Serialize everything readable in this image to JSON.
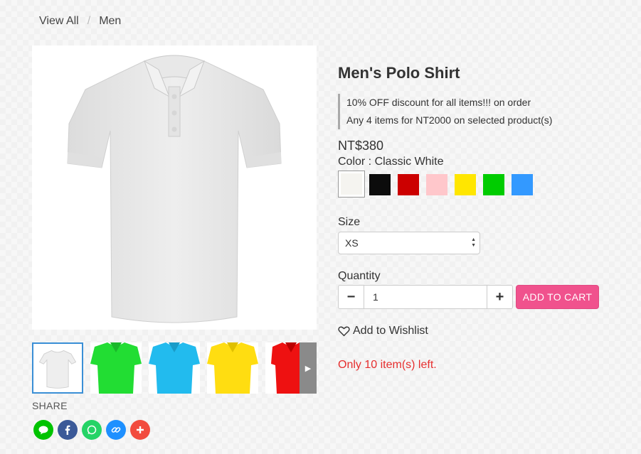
{
  "breadcrumb": {
    "items": [
      "View All",
      "Men"
    ],
    "separator": "/"
  },
  "product": {
    "title": "Men's Polo Shirt",
    "promotions": [
      "10% OFF discount for all items!!! on order",
      "Any 4 items for NT2000 on selected product(s)"
    ],
    "price": "NT$380",
    "color_label": "Color : Classic White",
    "colors": [
      "#f5f4f0",
      "#0c0c0c",
      "#cc0000",
      "#ffc7cb",
      "#ffe600",
      "#00cc00",
      "#3399ff"
    ],
    "selected_color_index": 0
  },
  "size": {
    "label": "Size",
    "value": "XS"
  },
  "quantity": {
    "label": "Quantity",
    "value": "1",
    "minus": "−",
    "plus": "+"
  },
  "add_to_cart": "ADD TO CART",
  "wishlist": "Add to Wishlist",
  "stock": "Only 10 item(s) left.",
  "gallery": {
    "thumbnail_colors": [
      "#f0f0f0",
      "#22dd33",
      "#22bbee",
      "#ffdd11",
      "#ee1111"
    ],
    "active_index": 0
  },
  "share": {
    "label": "SHARE",
    "buttons": [
      {
        "name": "line",
        "color": "#00c300",
        "icon": "line-icon"
      },
      {
        "name": "facebook",
        "color": "#3b5998",
        "icon": "facebook-icon"
      },
      {
        "name": "whatsapp",
        "color": "#25d366",
        "icon": "whatsapp-icon"
      },
      {
        "name": "copy-link",
        "color": "#1e90ff",
        "icon": "link-icon"
      },
      {
        "name": "more",
        "color": "#f24b3e",
        "icon": "plus-icon"
      }
    ]
  }
}
